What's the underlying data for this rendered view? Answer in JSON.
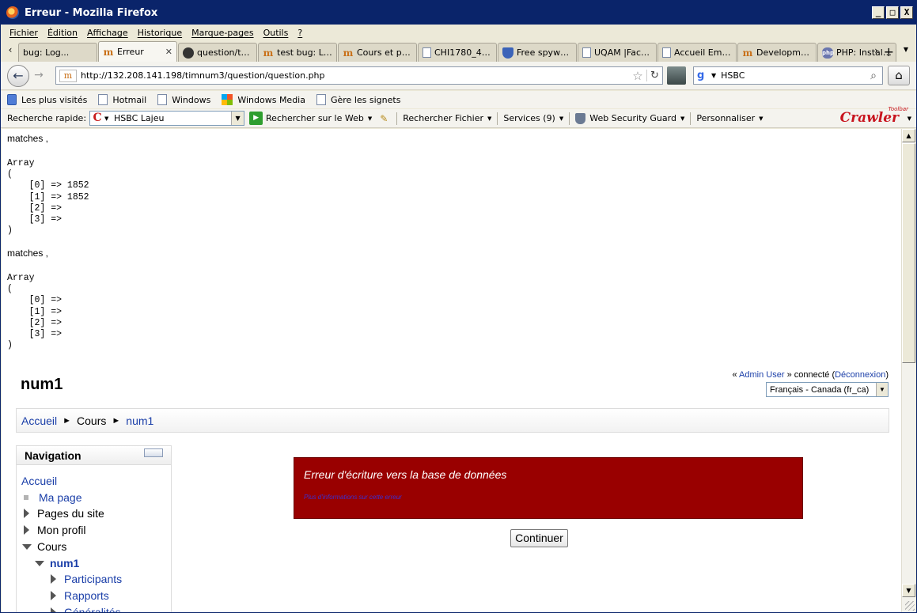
{
  "window": {
    "title": "Erreur - Mozilla Firefox",
    "minimize": "_",
    "maximize": "□",
    "close": "X"
  },
  "menu": [
    "Fichier",
    "Édition",
    "Affichage",
    "Historique",
    "Marque-pages",
    "Outils",
    "?"
  ],
  "tabs": [
    {
      "label": "bug: Log...",
      "favicon": "none"
    },
    {
      "label": "Erreur",
      "favicon": "moodle-icon",
      "active": true
    },
    {
      "label": "question/typ...",
      "favicon": "github-icon"
    },
    {
      "label": "test bug: Log...",
      "favicon": "moodle-icon"
    },
    {
      "label": "Cours et pro...",
      "favicon": "moodle-icon"
    },
    {
      "label": "CHI1780_40:...",
      "favicon": "document-icon"
    },
    {
      "label": "Free spywar...",
      "favicon": "shield-icon"
    },
    {
      "label": "UQAM |Facul...",
      "favicon": "document-icon"
    },
    {
      "label": "Accueil Emplo...",
      "favicon": "document-icon"
    },
    {
      "label": "Development...",
      "favicon": "moodle-icon"
    },
    {
      "label": "PHP: Installa...",
      "favicon": "php-icon"
    }
  ],
  "navbar": {
    "url": "http://132.208.141.198/timnum3/question/question.php",
    "search_value": "HSBC"
  },
  "bookmarks": [
    {
      "label": "Les plus visités",
      "icon": "most-visited-icon"
    },
    {
      "label": "Hotmail",
      "icon": "document-icon"
    },
    {
      "label": "Windows",
      "icon": "document-icon"
    },
    {
      "label": "Windows Media",
      "icon": "windows-icon"
    },
    {
      "label": "Gère les signets",
      "icon": "document-icon"
    }
  ],
  "crawler": {
    "quick_search_label": "Recherche rapide:",
    "quick_search_value": "HSBC Lajeu",
    "web_search": "Rechercher sur le Web",
    "file_search": "Rechercher Fichier",
    "services": "Services (9)",
    "guard": "Web Security Guard",
    "customize": "Personnaliser",
    "logo": "Crawler",
    "logo_small": "Toolbar"
  },
  "debug": {
    "matches_label_1": "matches ,",
    "array_1": "Array\n(\n    [0] => 1852\n    [1] => 1852\n    [2] =>\n    [3] =>\n)",
    "matches_label_2": "matches ,",
    "array_2": "Array\n(\n    [0] =>\n    [1] =>\n    [2] =>\n    [3] =>\n)"
  },
  "page": {
    "site_title": "num1",
    "login_prefix": "« ",
    "login_user": "Admin User",
    "login_mid": " » connecté (",
    "logout": "Déconnexion",
    "login_suffix": ")",
    "language": "Français - Canada (fr_ca)",
    "breadcrumb": [
      "Accueil",
      "Cours",
      "num1"
    ],
    "breadcrumb_sep": "►"
  },
  "navigation": {
    "title": "Navigation",
    "items": [
      {
        "label": "Accueil",
        "type": "link"
      },
      {
        "label": "Ma page",
        "type": "bullet"
      },
      {
        "label": "Pages du site",
        "type": "collapsed"
      },
      {
        "label": "Mon profil",
        "type": "collapsed"
      },
      {
        "label": "Cours",
        "type": "expanded"
      },
      {
        "label": "num1",
        "type": "expanded-current"
      },
      {
        "label": "Participants",
        "type": "collapsed-link"
      },
      {
        "label": "Rapports",
        "type": "collapsed-link"
      },
      {
        "label": "Généralités",
        "type": "collapsed-link"
      }
    ]
  },
  "error": {
    "message": "Erreur d'écriture vers la base de données",
    "more_info": "Plus d'informations sur cette erreur",
    "continue": "Continuer"
  },
  "colors": {
    "error_bg": "#990000",
    "link": "#1a3ea8",
    "title_bar": "#0a246a"
  }
}
